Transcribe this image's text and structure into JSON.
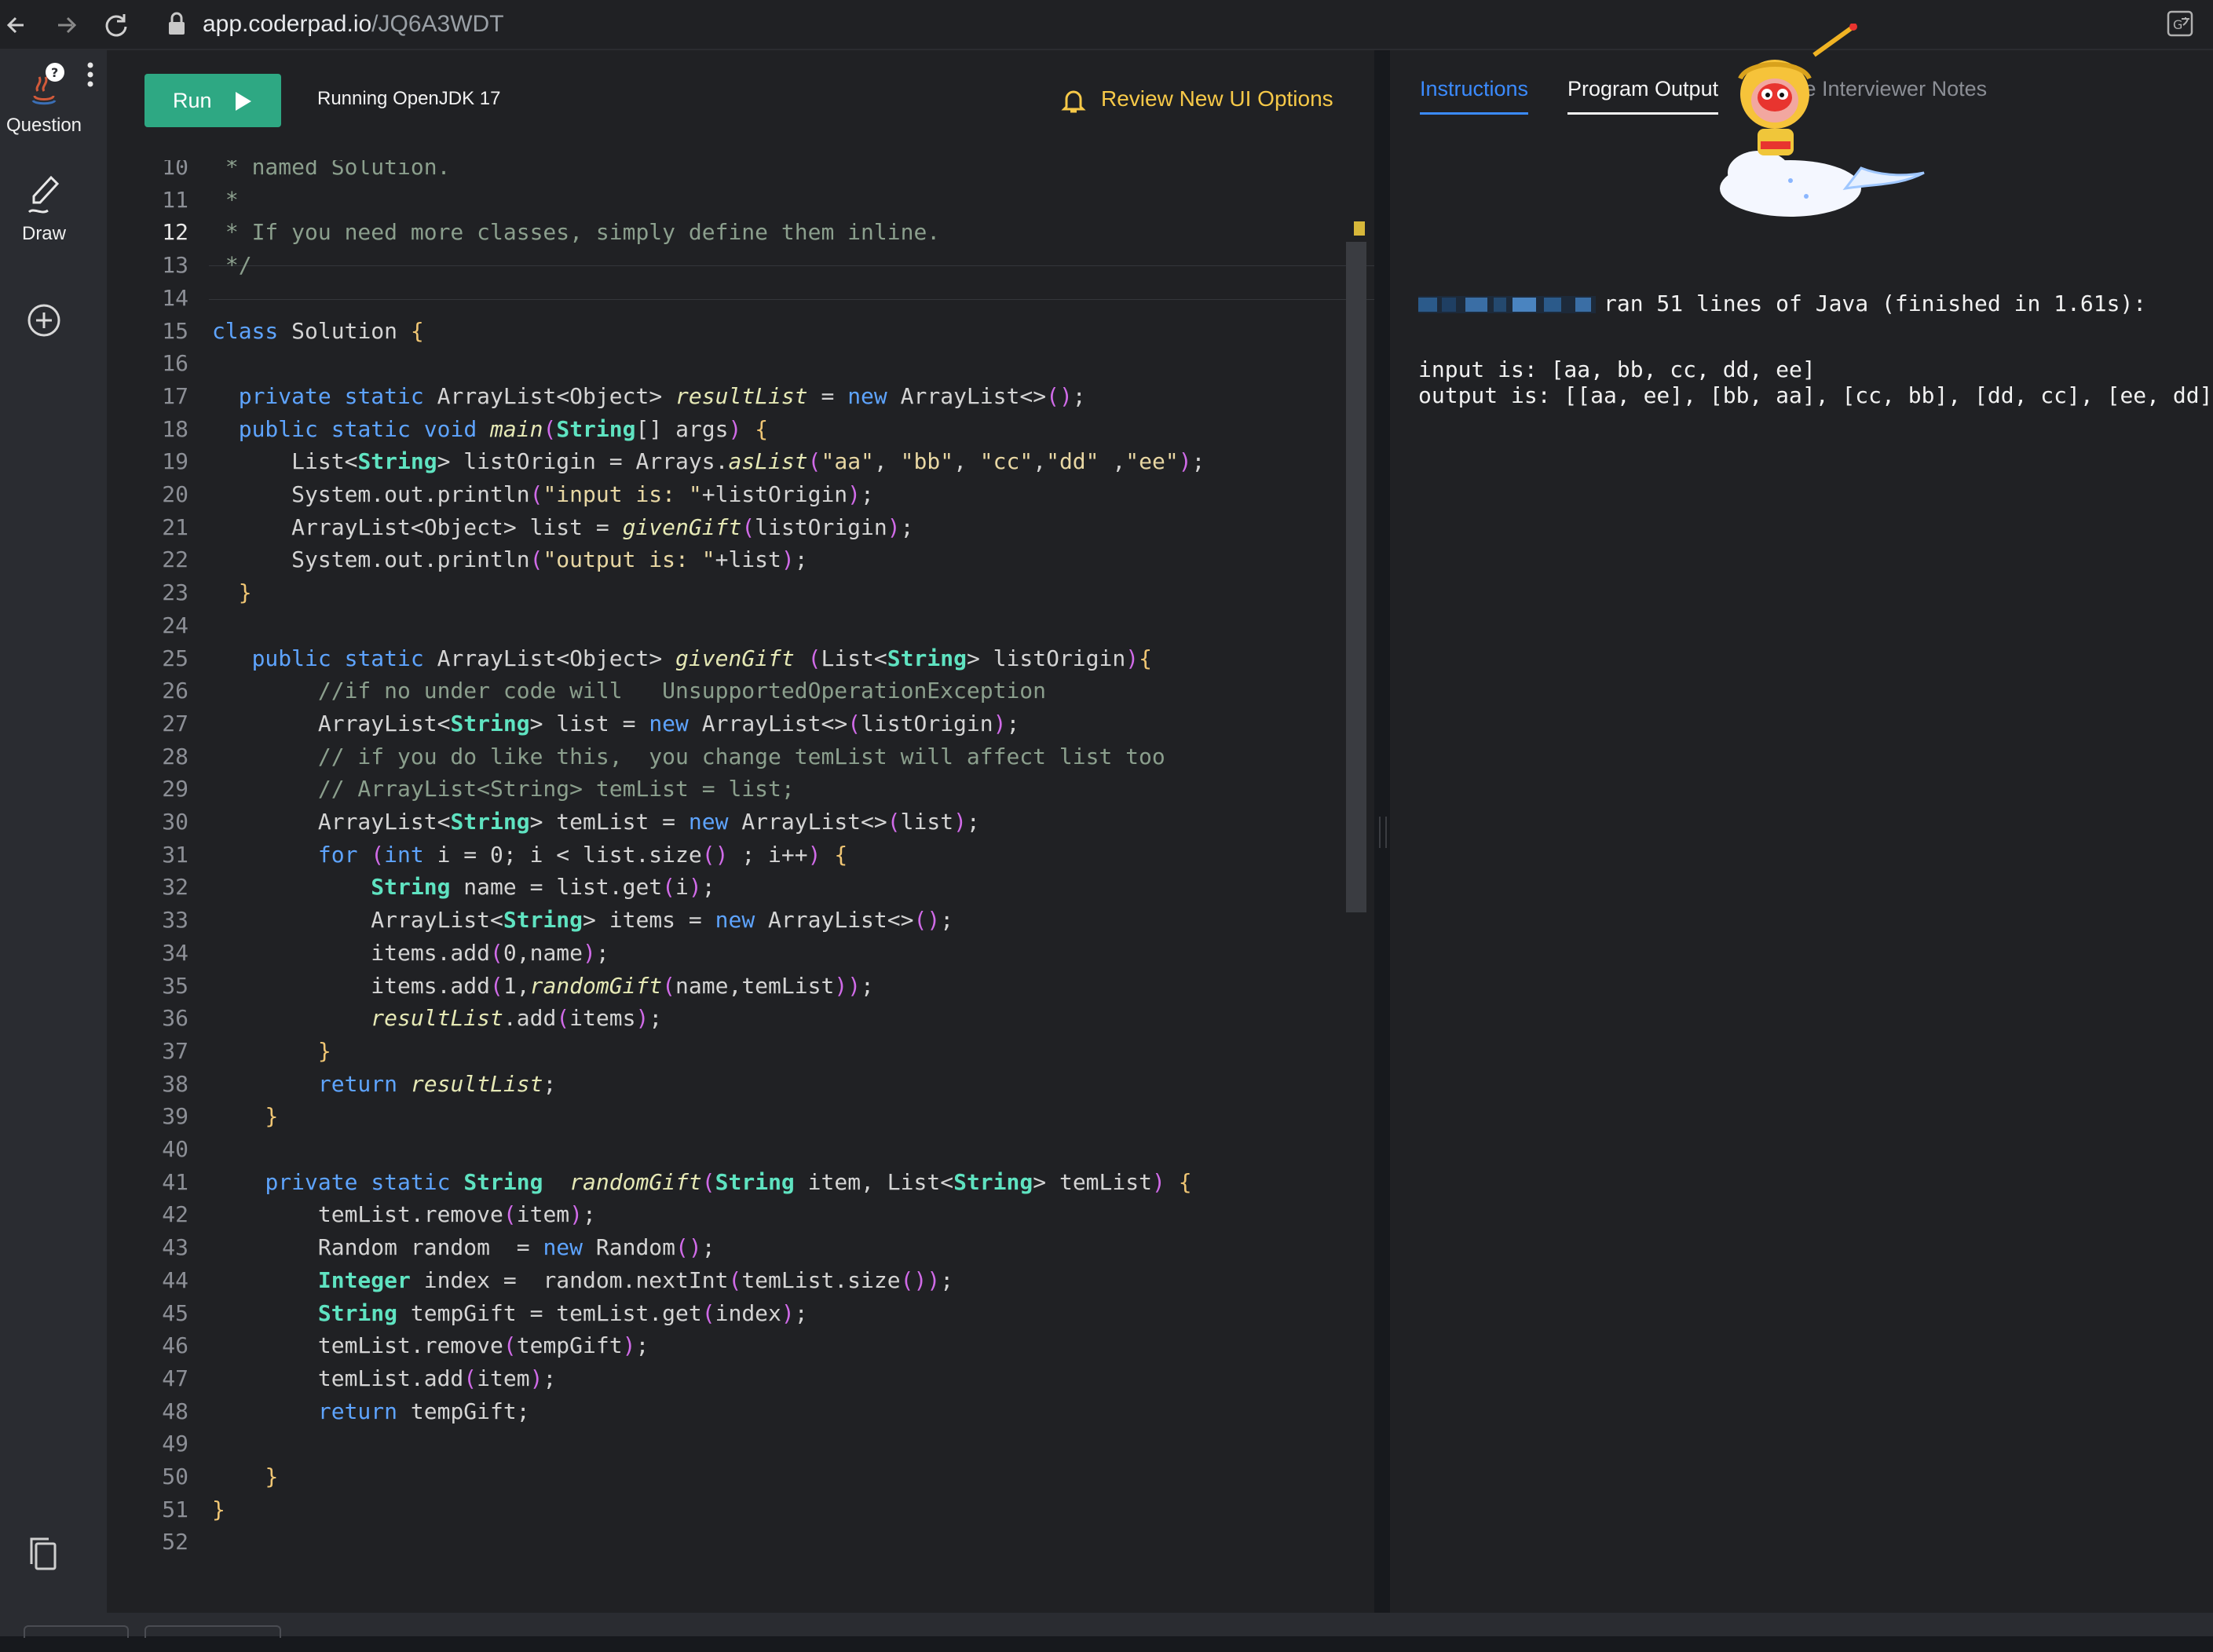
{
  "browser": {
    "url_host": "app.coderpad.io",
    "url_path": "/JQ6A3WDT"
  },
  "rail": {
    "question_label": "Question",
    "draw_label": "Draw"
  },
  "toolbar": {
    "run_label": "Run",
    "runtime_label": "Running OpenJDK 17",
    "review_label": "Review New UI Options"
  },
  "editor": {
    "lines": [
      {
        "no": "10",
        "text": " * named Solution."
      },
      {
        "no": "11",
        "text": " *"
      },
      {
        "no": "12",
        "text": " * If you need more classes, simply define them inline."
      },
      {
        "no": "13",
        "text": " */"
      },
      {
        "no": "14",
        "text": ""
      },
      {
        "no": "15",
        "text": "class Solution {"
      },
      {
        "no": "16",
        "text": ""
      },
      {
        "no": "17",
        "text": "  private static ArrayList<Object> resultList = new ArrayList<>();"
      },
      {
        "no": "18",
        "text": "  public static void main(String[] args) {"
      },
      {
        "no": "19",
        "text": "      List<String> listOrigin = Arrays.asList(\"aa\", \"bb\", \"cc\",\"dd\" ,\"ee\");"
      },
      {
        "no": "20",
        "text": "      System.out.println(\"input is: \"+listOrigin);"
      },
      {
        "no": "21",
        "text": "      ArrayList<Object> list = givenGift(listOrigin);"
      },
      {
        "no": "22",
        "text": "      System.out.println(\"output is: \"+list);"
      },
      {
        "no": "23",
        "text": "  }"
      },
      {
        "no": "24",
        "text": ""
      },
      {
        "no": "25",
        "text": "   public static ArrayList<Object> givenGift (List<String> listOrigin){"
      },
      {
        "no": "26",
        "text": "        //if no under code will   UnsupportedOperationException"
      },
      {
        "no": "27",
        "text": "        ArrayList<String> list = new ArrayList<>(listOrigin);"
      },
      {
        "no": "28",
        "text": "        // if you do like this,  you change temList will affect list too"
      },
      {
        "no": "29",
        "text": "        // ArrayList<String> temList = list;"
      },
      {
        "no": "30",
        "text": "        ArrayList<String> temList = new ArrayList<>(list);"
      },
      {
        "no": "31",
        "text": "        for (int i = 0; i < list.size() ; i++) {"
      },
      {
        "no": "32",
        "text": "            String name = list.get(i);"
      },
      {
        "no": "33",
        "text": "            ArrayList<String> items = new ArrayList<>();"
      },
      {
        "no": "34",
        "text": "            items.add(0,name);"
      },
      {
        "no": "35",
        "text": "            items.add(1,randomGift(name,temList));"
      },
      {
        "no": "36",
        "text": "            resultList.add(items);"
      },
      {
        "no": "37",
        "text": "        }"
      },
      {
        "no": "38",
        "text": "        return resultList;"
      },
      {
        "no": "39",
        "text": "    }"
      },
      {
        "no": "40",
        "text": ""
      },
      {
        "no": "41",
        "text": "    private static String  randomGift(String item, List<String> temList) {"
      },
      {
        "no": "42",
        "text": "        temList.remove(item);"
      },
      {
        "no": "43",
        "text": "        Random random  = new Random();"
      },
      {
        "no": "44",
        "text": "        Integer index =  random.nextInt(temList.size());"
      },
      {
        "no": "45",
        "text": "        String tempGift = temList.get(index);"
      },
      {
        "no": "46",
        "text": "        temList.remove(tempGift);"
      },
      {
        "no": "47",
        "text": "        temList.add(item);"
      },
      {
        "no": "48",
        "text": "        return tempGift;"
      },
      {
        "no": "49",
        "text": ""
      },
      {
        "no": "50",
        "text": "    }"
      },
      {
        "no": "51",
        "text": "}"
      },
      {
        "no": "52",
        "text": ""
      }
    ]
  },
  "right_panel": {
    "tabs": [
      "Instructions",
      "Program Output",
      "Private Interviewer Notes"
    ],
    "tab_visible_notes": "te Interviewer Notes",
    "output_header": "ran 51 lines of Java (finished in 1.61s):",
    "output_input": "input is: [aa, bb, cc, dd, ee]",
    "output_output": "output is: [[aa, ee], [bb, aa], [cc, bb], [dd, cc], [ee, dd]]"
  },
  "colors": {
    "run_button": "#2ea883",
    "accent_tab": "#3b8bff",
    "review_text": "#f7c948"
  }
}
